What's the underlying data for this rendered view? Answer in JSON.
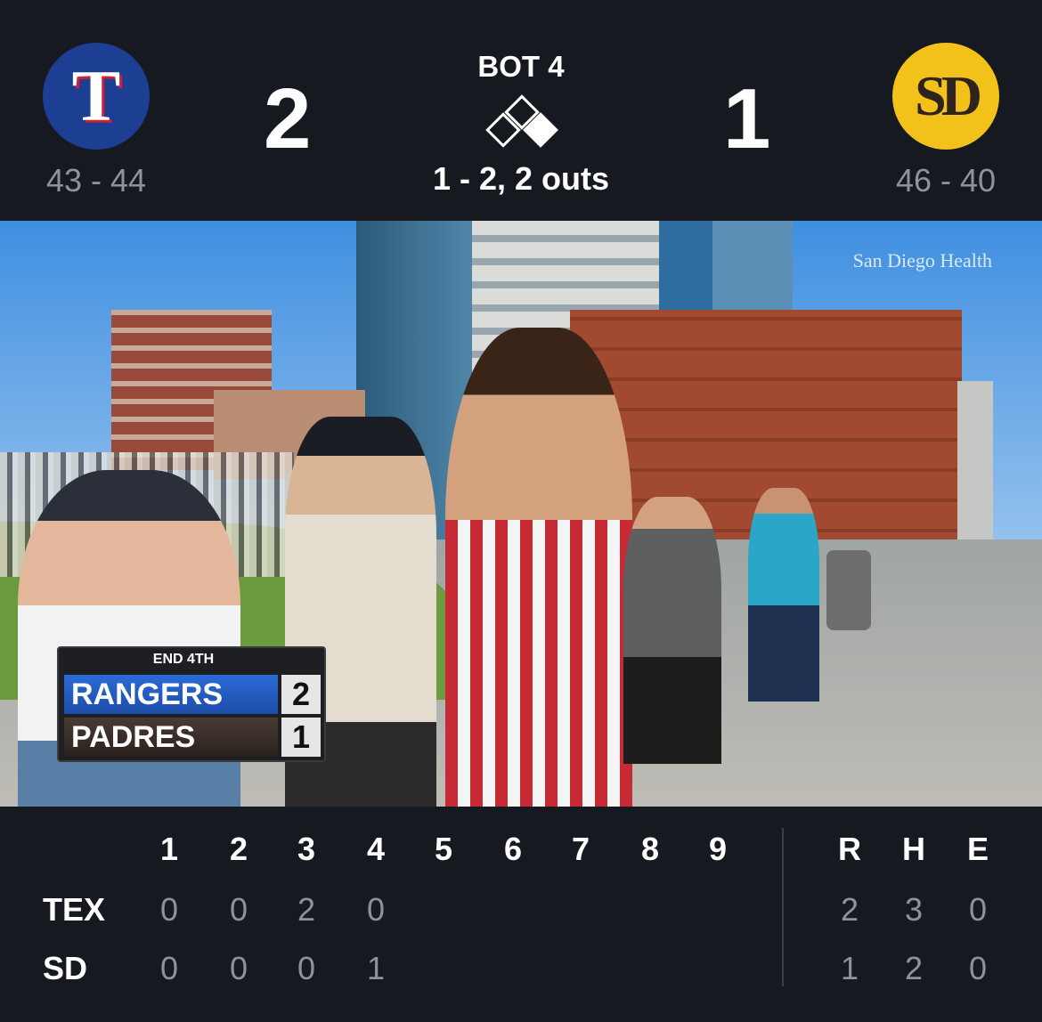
{
  "header": {
    "away": {
      "logo_text": "T",
      "record": "43 - 44",
      "score": "2",
      "logo_color": "#1c3f94"
    },
    "home": {
      "logo_text": "SD",
      "record": "46 - 40",
      "score": "1",
      "logo_color": "#f2c21a"
    },
    "inning": "BOT 4",
    "count": "1 - 2, 2 outs",
    "bases": {
      "first": true,
      "second": false,
      "third": false
    }
  },
  "video": {
    "watermark": "San Diego Health",
    "score_bug": {
      "title": "END 4TH",
      "rows": [
        {
          "team": "RANGERS",
          "score": "2"
        },
        {
          "team": "PADRES",
          "score": "1"
        }
      ]
    }
  },
  "linescore": {
    "innings": [
      "1",
      "2",
      "3",
      "4",
      "5",
      "6",
      "7",
      "8",
      "9"
    ],
    "totals_headers": [
      "R",
      "H",
      "E"
    ],
    "rows": [
      {
        "team": "TEX",
        "innings": [
          "0",
          "0",
          "2",
          "0",
          "",
          "",
          "",
          "",
          ""
        ],
        "totals": [
          "2",
          "3",
          "0"
        ]
      },
      {
        "team": "SD",
        "innings": [
          "0",
          "0",
          "0",
          "1",
          "",
          "",
          "",
          "",
          ""
        ],
        "totals": [
          "1",
          "2",
          "0"
        ]
      }
    ]
  }
}
